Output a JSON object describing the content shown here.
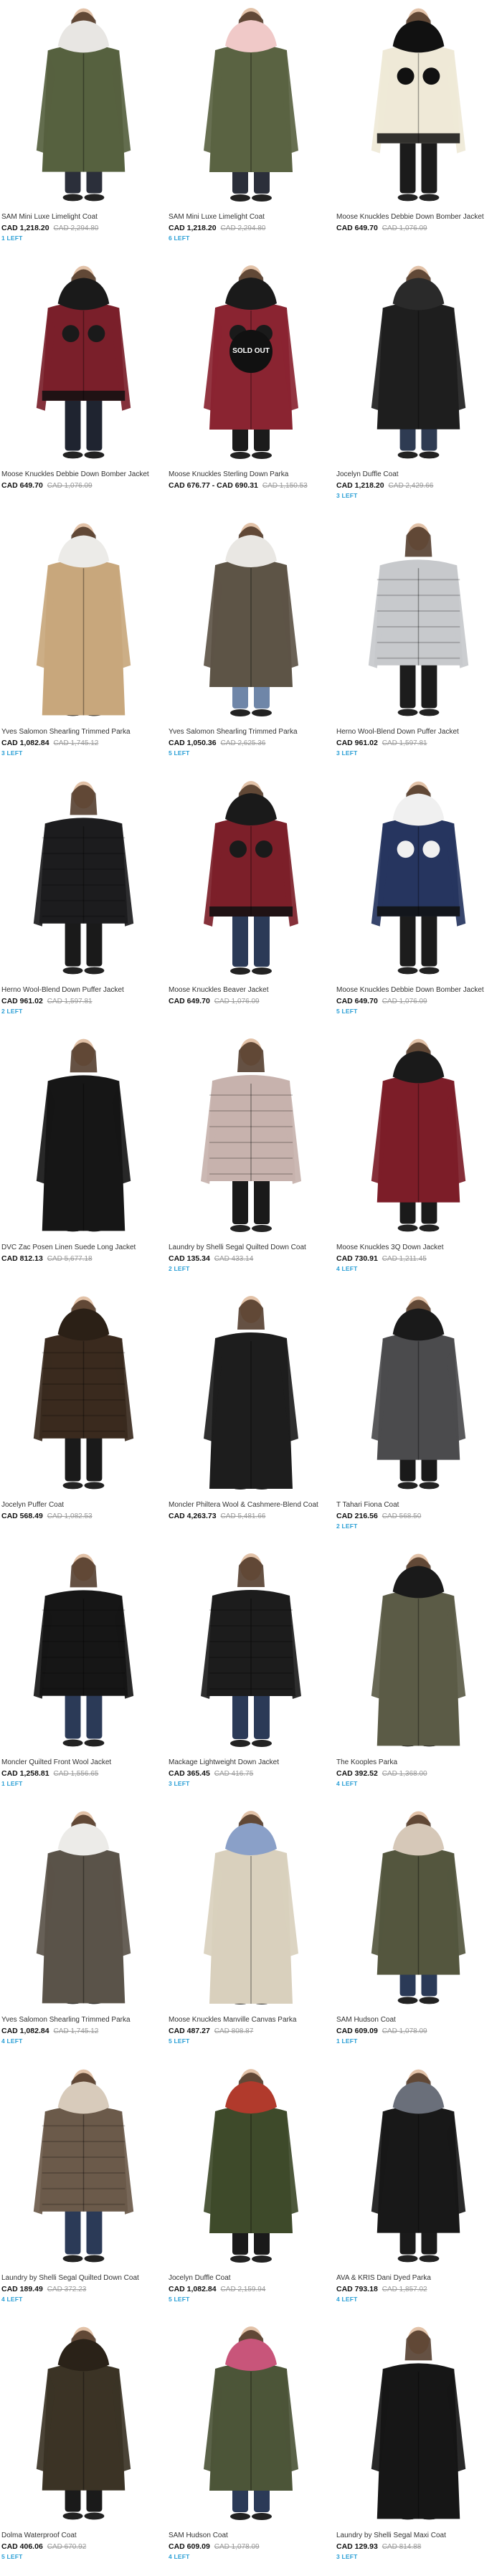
{
  "currency": "CAD",
  "colors": {
    "accent_blue": "#2a9fd6",
    "strike_gray": "#999999"
  },
  "products": [
    {
      "name": "SAM Mini Luxe Limelight Coat",
      "price": "CAD 1,218.20",
      "orig": "CAD 2,294.80",
      "left": "1 LEFT",
      "coat": "#56613f",
      "fur": "#e8e6e3",
      "pants": "#2b2f3a",
      "shape": "parka",
      "collar": "fur"
    },
    {
      "name": "SAM Mini Luxe Limelight Coat",
      "price": "CAD 1,218.20",
      "orig": "CAD 2,294.80",
      "left": "6 LEFT",
      "coat": "#5a6342",
      "fur": "#f0c9c8",
      "pants": "#2b2f3a",
      "shape": "parka",
      "collar": "fur"
    },
    {
      "name": "Moose Knuckles Debbie Down Bomber Jacket",
      "price": "CAD 649.70",
      "orig": "CAD 1,076.09",
      "left": "",
      "coat": "#efe9d7",
      "fur": "#111111",
      "pants": "#1b1b1b",
      "shape": "bomber",
      "collar": "pom"
    },
    {
      "name": "Moose Knuckles Debbie Down Bomber Jacket",
      "price": "CAD 649.70",
      "orig": "CAD 1,076.09",
      "left": "",
      "coat": "#7a1f2a",
      "fur": "#1a1a1a",
      "pants": "#1f2430",
      "shape": "bomber",
      "collar": "pom"
    },
    {
      "name": "Moose Knuckles Sterling Down Parka",
      "price": "CAD 676.77 - CAD 690.31",
      "orig": "CAD 1,150.53",
      "left": "",
      "coat": "#8a2431",
      "fur": "#1a1a1a",
      "pants": "#1b1b1b",
      "shape": "parka",
      "collar": "pom",
      "sold": "SOLD OUT"
    },
    {
      "name": "Jocelyn Duffle Coat",
      "price": "CAD 1,218.20",
      "orig": "CAD 2,429.66",
      "left": "3 LEFT",
      "coat": "#1e1e1e",
      "fur": "#2a2a2a",
      "pants": "#2e3b52",
      "shape": "parka",
      "collar": "fur"
    },
    {
      "name": "Yves Salomon Shearling Trimmed Parka",
      "price": "CAD 1,082.84",
      "orig": "CAD 1,745.12",
      "left": "3 LEFT",
      "coat": "#c8a77c",
      "fur": "#ecebe8",
      "pants": "#5e6a7a",
      "shape": "long",
      "collar": "fur"
    },
    {
      "name": "Yves Salomon Shearling Trimmed Parka",
      "price": "CAD 1,050.36",
      "orig": "CAD 2,625.36",
      "left": "5 LEFT",
      "coat": "#5d5446",
      "fur": "#e9e7e3",
      "pants": "#6f86a8",
      "shape": "parka",
      "collar": "fur"
    },
    {
      "name": "Herno Wool-Blend Down Puffer Jacket",
      "price": "CAD 961.02",
      "orig": "CAD 1,597.81",
      "left": "3 LEFT",
      "coat": "#c7c9cc",
      "fur": "#b9bcc0",
      "pants": "#1c1c1c",
      "shape": "puffer",
      "collar": "none"
    },
    {
      "name": "Herno Wool-Blend Down Puffer Jacket",
      "price": "CAD 961.02",
      "orig": "CAD 1,597.81",
      "left": "2 LEFT",
      "coat": "#1c1c1e",
      "fur": "#222",
      "pants": "#1a1a1a",
      "shape": "puffer",
      "collar": "none"
    },
    {
      "name": "Moose Knuckles Beaver Jacket",
      "price": "CAD 649.70",
      "orig": "CAD 1,076.09",
      "left": "",
      "coat": "#7c1f29",
      "fur": "#1a1a1a",
      "pants": "#2b3a57",
      "shape": "bomber",
      "collar": "pom"
    },
    {
      "name": "Moose Knuckles Debbie Down Bomber Jacket",
      "price": "CAD 649.70",
      "orig": "CAD 1,076.09",
      "left": "5 LEFT",
      "coat": "#26355f",
      "fur": "#f0f0f0",
      "pants": "#1c1c1c",
      "shape": "bomber",
      "collar": "pom"
    },
    {
      "name": "DVC Zac Posen Linen Suede Long Jacket",
      "price": "CAD 812.13",
      "orig": "CAD 5,677.18",
      "left": "",
      "coat": "#161616",
      "fur": "#161616",
      "pants": "#1a1a1a",
      "shape": "long",
      "collar": "none"
    },
    {
      "name": "Laundry by Shelli Segal Quilted Down Coat",
      "price": "CAD 135.34",
      "orig": "CAD 433.14",
      "left": "2 LEFT",
      "coat": "#c7b2ad",
      "fur": "#c7b2ad",
      "pants": "#1a1a1a",
      "shape": "puffer",
      "collar": "none"
    },
    {
      "name": "Moose Knuckles 3Q Down Jacket",
      "price": "CAD 730.91",
      "orig": "CAD 1,211.45",
      "left": "4 LEFT",
      "coat": "#7c1d28",
      "fur": "#1a1a1a",
      "pants": "#1a1a1a",
      "shape": "parka",
      "collar": "fur"
    },
    {
      "name": "Jocelyn Puffer Coat",
      "price": "CAD 568.49",
      "orig": "CAD 1,082.53",
      "left": "",
      "coat": "#3a2a1e",
      "fur": "#2b2016",
      "pants": "#1a1a1a",
      "shape": "puffer",
      "collar": "fur"
    },
    {
      "name": "Moncler Philtera Wool & Cashmere-Blend Coat",
      "price": "CAD 4,263.73",
      "orig": "CAD 5,481.66",
      "left": "",
      "coat": "#1d1d1d",
      "fur": "#1d1d1d",
      "pants": "#2b3a57",
      "shape": "long",
      "collar": "none"
    },
    {
      "name": "T Tahari Fiona Coat",
      "price": "CAD 216.56",
      "orig": "CAD 568.50",
      "left": "2 LEFT",
      "coat": "#4b4b4d",
      "fur": "#1a1a1a",
      "pants": "#1a1a1a",
      "shape": "parka",
      "collar": "fur"
    },
    {
      "name": "Moncler Quilted Front Wool Jacket",
      "price": "CAD 1,258.81",
      "orig": "CAD 1,556.65",
      "left": "1 LEFT",
      "coat": "#161616",
      "fur": "#161616",
      "pants": "#2b3a57",
      "shape": "puffer",
      "collar": "none"
    },
    {
      "name": "Mackage Lightweight Down Jacket",
      "price": "CAD 365.45",
      "orig": "CAD 416.75",
      "left": "3 LEFT",
      "coat": "#1c1c1c",
      "fur": "#1c1c1c",
      "pants": "#2b3a57",
      "shape": "puffer",
      "collar": "none"
    },
    {
      "name": "The Kooples Parka",
      "price": "CAD 392.52",
      "orig": "CAD 1,368.00",
      "left": "4 LEFT",
      "coat": "#5b5b46",
      "fur": "#1a1a1a",
      "pants": "#1a1a1a",
      "shape": "long",
      "collar": "fur"
    },
    {
      "name": "Yves Salomon Shearling Trimmed Parka",
      "price": "CAD 1,082.84",
      "orig": "CAD 1,745.12",
      "left": "4 LEFT",
      "coat": "#5a5349",
      "fur": "#ecebe8",
      "pants": "#1a1a1a",
      "shape": "long",
      "collar": "fur"
    },
    {
      "name": "Moose Knuckles Manville Canvas Parka",
      "price": "CAD 487.27",
      "orig": "CAD 808.87",
      "left": "5 LEFT",
      "coat": "#d9d0bd",
      "fur": "#8aa0c8",
      "pants": "#1a1a1a",
      "shape": "long",
      "collar": "fur"
    },
    {
      "name": "SAM Hudson Coat",
      "price": "CAD 609.09",
      "orig": "CAD 1,078.09",
      "left": "1 LEFT",
      "coat": "#54563e",
      "fur": "#d6c8b8",
      "pants": "#2b3a57",
      "shape": "parka",
      "collar": "fur"
    },
    {
      "name": "Laundry by Shelli Segal Quilted Down Coat",
      "price": "CAD 189.49",
      "orig": "CAD 372.23",
      "left": "4 LEFT",
      "coat": "#6b5a4a",
      "fur": "#d8cbbb",
      "pants": "#2b3a57",
      "shape": "puffer",
      "collar": "fur"
    },
    {
      "name": "Jocelyn Duffle Coat",
      "price": "CAD 1,082.84",
      "orig": "CAD 2,159.94",
      "left": "5 LEFT",
      "coat": "#3e4a2a",
      "fur": "#b13a2c",
      "pants": "#1a1a1a",
      "shape": "parka",
      "collar": "fur"
    },
    {
      "name": "AVA & KRIS Dani Dyed Parka",
      "price": "CAD 793.18",
      "orig": "CAD 1,857.02",
      "left": "4 LEFT",
      "coat": "#181818",
      "fur": "#6a6f7a",
      "pants": "#1a1a1a",
      "shape": "parka",
      "collar": "fur"
    },
    {
      "name": "Dolma Waterproof Coat",
      "price": "CAD 406.06",
      "orig": "CAD 670.92",
      "left": "5 LEFT",
      "coat": "#3b3325",
      "fur": "#2a2218",
      "pants": "#1a1a1a",
      "shape": "parka",
      "collar": "fur"
    },
    {
      "name": "SAM Hudson Coat",
      "price": "CAD 609.09",
      "orig": "CAD 1,078.09",
      "left": "4 LEFT",
      "coat": "#4c5538",
      "fur": "#c8557a",
      "pants": "#2b3a57",
      "shape": "parka",
      "collar": "fur"
    },
    {
      "name": "Laundry by Shelli Segal Maxi Coat",
      "price": "CAD 129.93",
      "orig": "CAD 814.88",
      "left": "3 LEFT",
      "coat": "#161616",
      "fur": "#161616",
      "pants": "#1a1a1a",
      "shape": "long",
      "collar": "none"
    }
  ]
}
